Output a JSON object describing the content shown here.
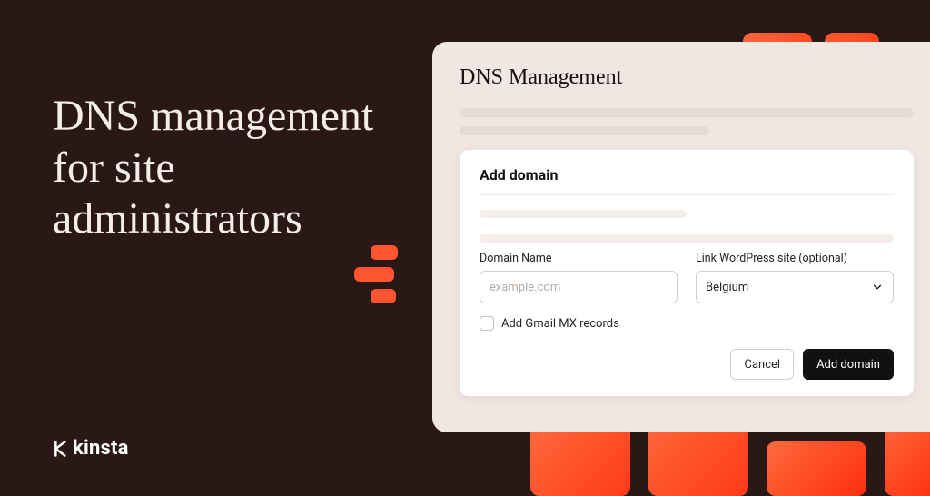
{
  "hero": {
    "title": "DNS management for site administrators",
    "brand": "kinsta"
  },
  "panel": {
    "title": "DNS Management"
  },
  "card": {
    "title": "Add domain",
    "domain_label": "Domain Name",
    "domain_placeholder": "example.com",
    "link_label": "Link WordPress site (optional)",
    "link_value": "Belgium",
    "checkbox_label": "Add Gmail MX records",
    "cancel": "Cancel",
    "submit": "Add domain"
  },
  "colors": {
    "bg": "#2a1816",
    "accent": "#ff5530",
    "panel": "#f1e7e2",
    "cream": "#f5eee8"
  }
}
